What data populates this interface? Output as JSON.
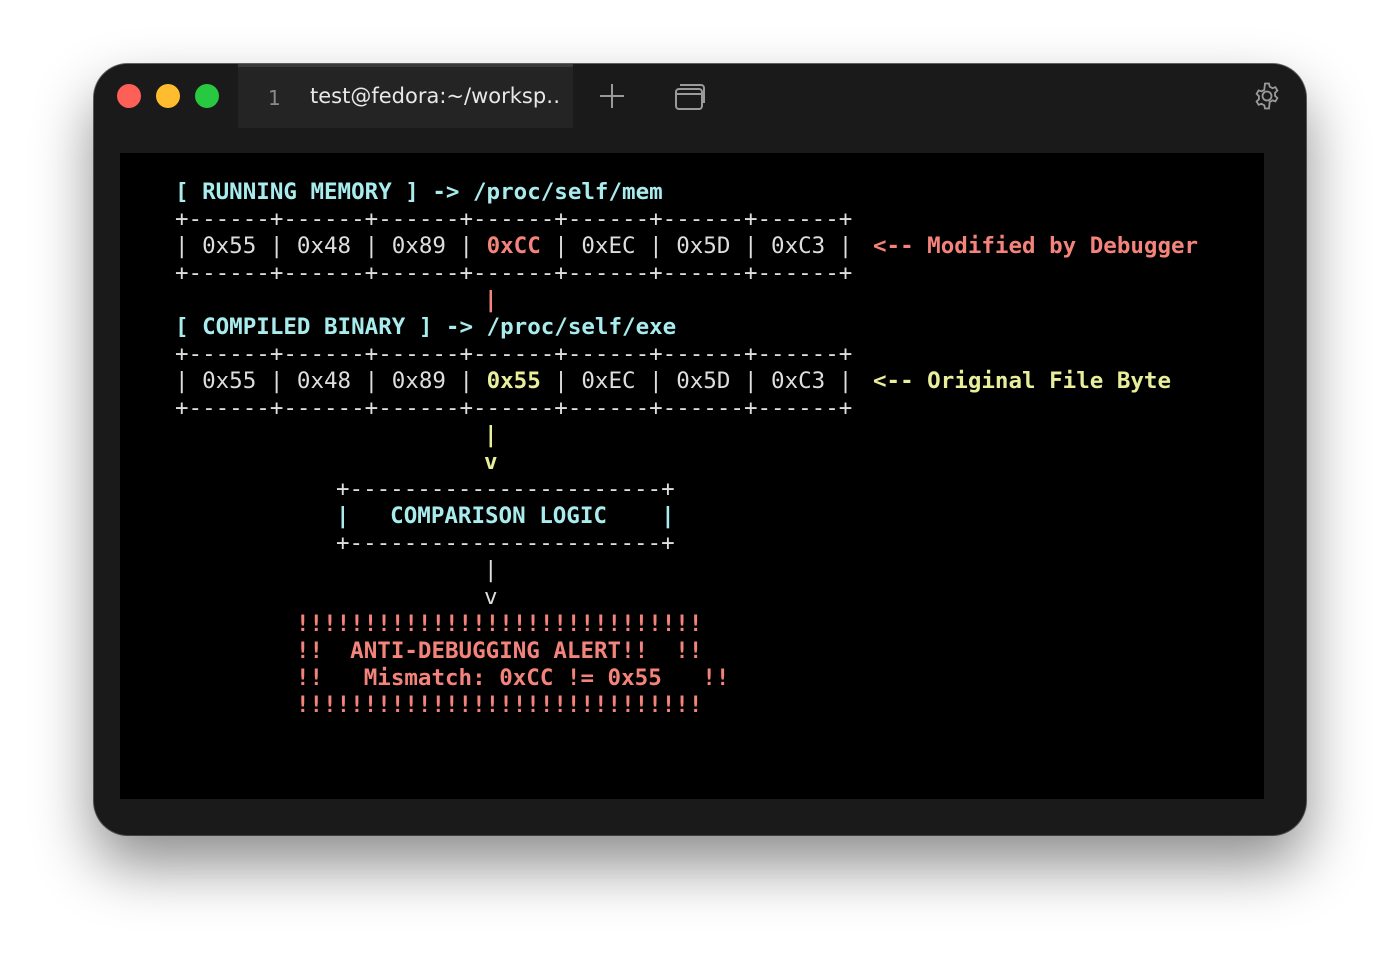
{
  "window": {
    "tab": {
      "index": "1",
      "title": "test@fedora:~/worksp…"
    }
  },
  "icons": {
    "new_tab": "plus-icon",
    "tab_overview": "tab-overview-icon",
    "settings": "gear-icon"
  },
  "colors": {
    "heading": "#a8ecee",
    "modified": "#f4837b",
    "original": "#e8ee9a",
    "alert": "#f4837b",
    "text": "#dedede"
  },
  "terminal": {
    "memory_heading": "[ RUNNING MEMORY ] -> /proc/self/mem",
    "memory_border_top": "+------+------+------+------+------+------+------+",
    "memory_row": {
      "prefix": "| 0x55 | 0x48 | 0x89 | ",
      "highlight": "0xCC",
      "suffix": " | 0xEC | 0x5D | 0xC3 |"
    },
    "memory_note": "<-- Modified by Debugger",
    "memory_border_bottom": "+------+------+------+------+------+------+------+",
    "pipe_red": "|",
    "binary_heading": "[ COMPILED BINARY ] -> /proc/self/exe",
    "binary_border_top": "+------+------+------+------+------+------+------+",
    "binary_row": {
      "prefix": "| 0x55 | 0x48 | 0x89 | ",
      "highlight": "0x55",
      "suffix": " | 0xEC | 0x5D | 0xC3 |"
    },
    "binary_note": "<-- Original File Byte",
    "binary_border_bottom": "+------+------+------+------+------+------+------+",
    "pipe_yellow": "|",
    "arrow_yellow": "v",
    "logic_border_top": "+-----------------------+",
    "logic_label": "|   COMPARISON LOGIC    |",
    "logic_border_bottom": "+-----------------------+",
    "pipe_white": "|",
    "arrow_white": "v",
    "alert_line_1": "!!!!!!!!!!!!!!!!!!!!!!!!!!!!!!",
    "alert_line_2": "!!  ANTI-DEBUGGING ALERT!!  !!",
    "alert_line_3": "!!   Mismatch: 0xCC != 0x55   !!",
    "alert_line_4": "!!!!!!!!!!!!!!!!!!!!!!!!!!!!!!"
  }
}
